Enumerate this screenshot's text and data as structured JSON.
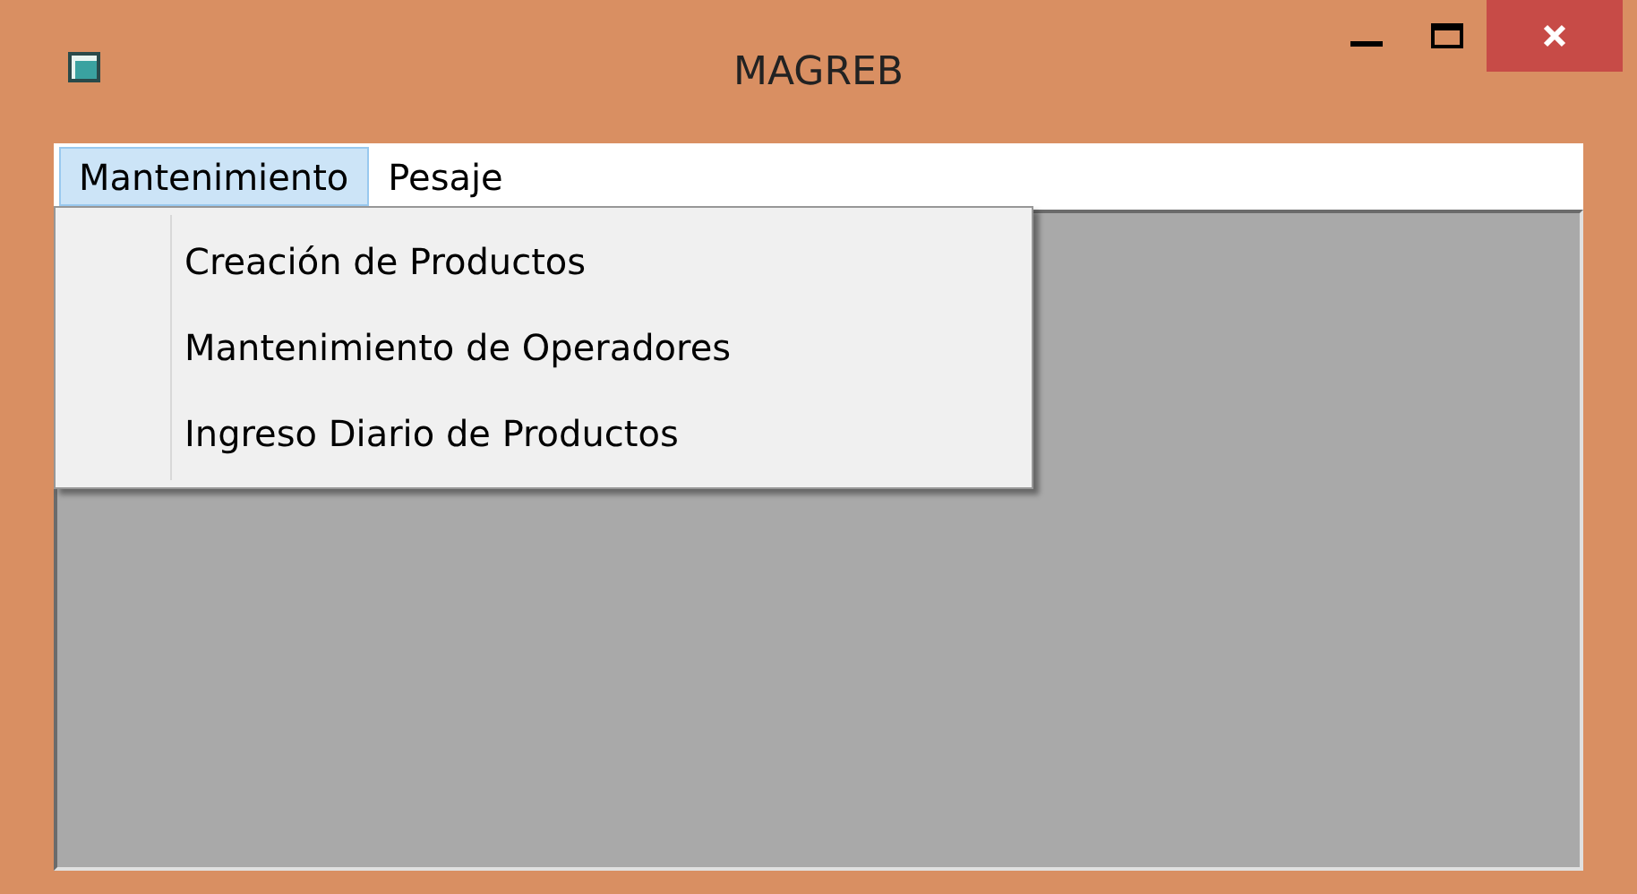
{
  "window": {
    "title": "MAGREB"
  },
  "menu_bar": [
    {
      "label": "Mantenimiento",
      "selected": true
    },
    {
      "label": "Pesaje",
      "selected": false
    }
  ],
  "dropdown": {
    "expanded": true,
    "items": [
      "Creación de Productos",
      "Mantenimiento de Operadores",
      "Ingreso Diario de Productos"
    ]
  }
}
